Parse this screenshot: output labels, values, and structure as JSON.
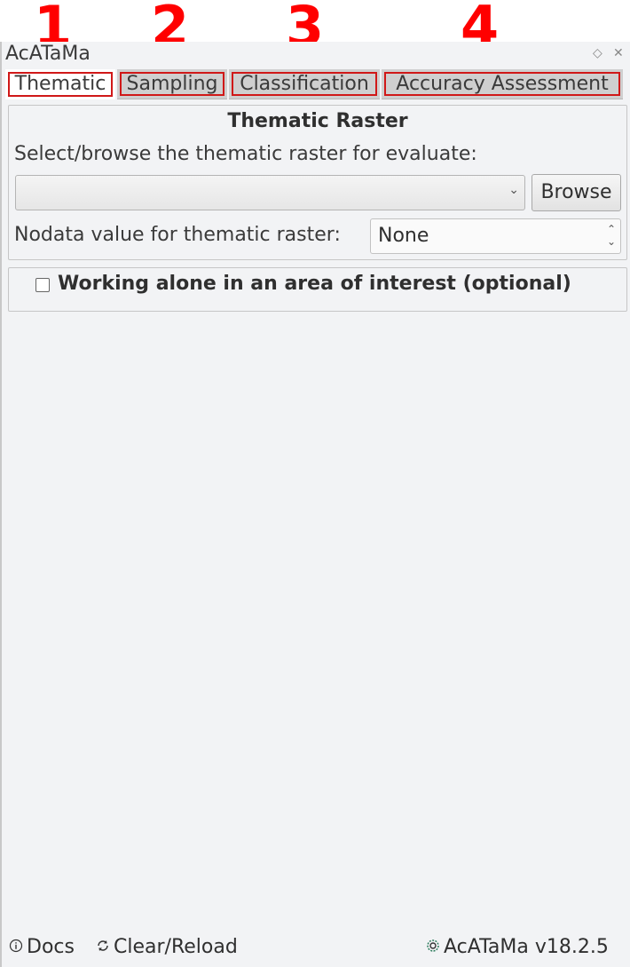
{
  "annotations": [
    "1",
    "2",
    "3",
    "4"
  ],
  "dock": {
    "title": "AcATaMa",
    "float_icon": "◇",
    "close_icon": "✕"
  },
  "tabs": [
    {
      "label": "Thematic",
      "active": true
    },
    {
      "label": "Sampling",
      "active": false
    },
    {
      "label": "Classification",
      "active": false
    },
    {
      "label": "Accuracy Assessment",
      "active": false
    }
  ],
  "thematic_raster": {
    "title": "Thematic Raster",
    "select_label": "Select/browse the thematic raster for evaluate:",
    "combo_value": "",
    "browse_label": "Browse",
    "nodata_label": "Nodata value for thematic raster:",
    "nodata_value": "None"
  },
  "aoi": {
    "checked": false,
    "label": "Working alone in an area of interest (optional)"
  },
  "footer": {
    "docs_label": "Docs",
    "reload_label": "Clear/Reload",
    "version_label": "AcATaMa v18.2.5"
  },
  "icons": {
    "docs": "info-icon",
    "reload": "reload-icon",
    "plugin": "acatama-logo-icon",
    "float": "float-icon",
    "close": "close-icon",
    "combo_arrow": "chevron-down-icon",
    "spin_arrows": "spin-updown-icon"
  },
  "colors": {
    "annotation": "#ff0000",
    "tab_highlight": "#d01818",
    "panel_bg": "#f2f3f5"
  }
}
